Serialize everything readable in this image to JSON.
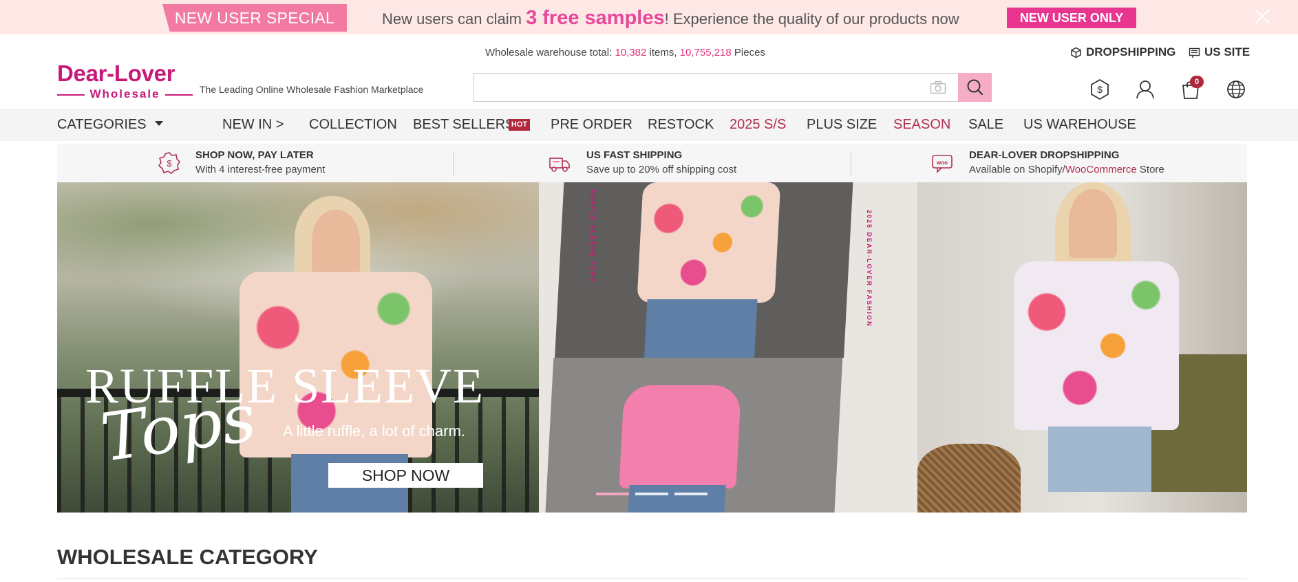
{
  "promo": {
    "tag": "NEW USER SPECIAL",
    "text_before": "New users can claim ",
    "highlight": "3 free samples",
    "text_after": "!  Experience the quality of our products now",
    "button": "NEW USER ONLY"
  },
  "header": {
    "logo_main": "Dear-Lover",
    "logo_sub": "Wholesale",
    "tagline": "The Leading Online Wholesale Fashion Marketplace",
    "warehouse_prefix": "Wholesale warehouse total: ",
    "warehouse_items": "10,382",
    "warehouse_items_label": " items, ",
    "warehouse_pieces": "10,755,218",
    "warehouse_pieces_label": " Pieces",
    "search_placeholder": "",
    "dropshipping_label": "DROPSHIPPING",
    "site_label": "US SITE",
    "cart_count": "0"
  },
  "nav": {
    "categories": "CATEGORIES",
    "items": [
      "NEW IN >",
      "COLLECTION",
      "BEST SELLERS",
      "PRE ORDER",
      "RESTOCK",
      "2025 S/S",
      "PLUS SIZE",
      "SEASON",
      "SALE",
      "US WAREHOUSE"
    ],
    "hot_badge": "HOT"
  },
  "benefits": [
    {
      "title": "SHOP NOW, PAY LATER",
      "subtitle": "With 4 interest-free payment"
    },
    {
      "title": "US FAST  SHIPPING",
      "subtitle": "Save up to 20% off shipping cost"
    },
    {
      "title": "DEAR-LOVER DROPSHIPPING",
      "subtitle_before": "Available on Shopify/",
      "subtitle_link": "WooCommerce",
      "subtitle_after": " Store"
    }
  ],
  "hero": {
    "title": "RUFFLE SLEEVE",
    "script": "Tops",
    "subtitle": "A little ruffle, a lot of charm.",
    "cta": "SHOP NOW",
    "side_text_a": "RUFFLE SLEEVE TOPS",
    "side_text_b": "2025 DEAR-LOVER FASHION",
    "active_slide": 1,
    "slide_count": 3
  },
  "section": {
    "title": "WHOLESALE CATEGORY"
  },
  "colors": {
    "brand": "#c8197a",
    "promo_bg": "#fde8e6",
    "promo_tag": "#f27aa2",
    "promo_button": "#e8358f",
    "accent_red": "#b0283a",
    "search_button": "#f5adc7"
  },
  "icons": {
    "promo_close": "close-icon",
    "camera": "camera-icon",
    "search": "search-icon",
    "dropshipping": "box-icon",
    "site": "flag-icon",
    "currency": "dollar-icon",
    "account": "user-icon",
    "cart": "bag-icon",
    "language": "globe-icon"
  }
}
